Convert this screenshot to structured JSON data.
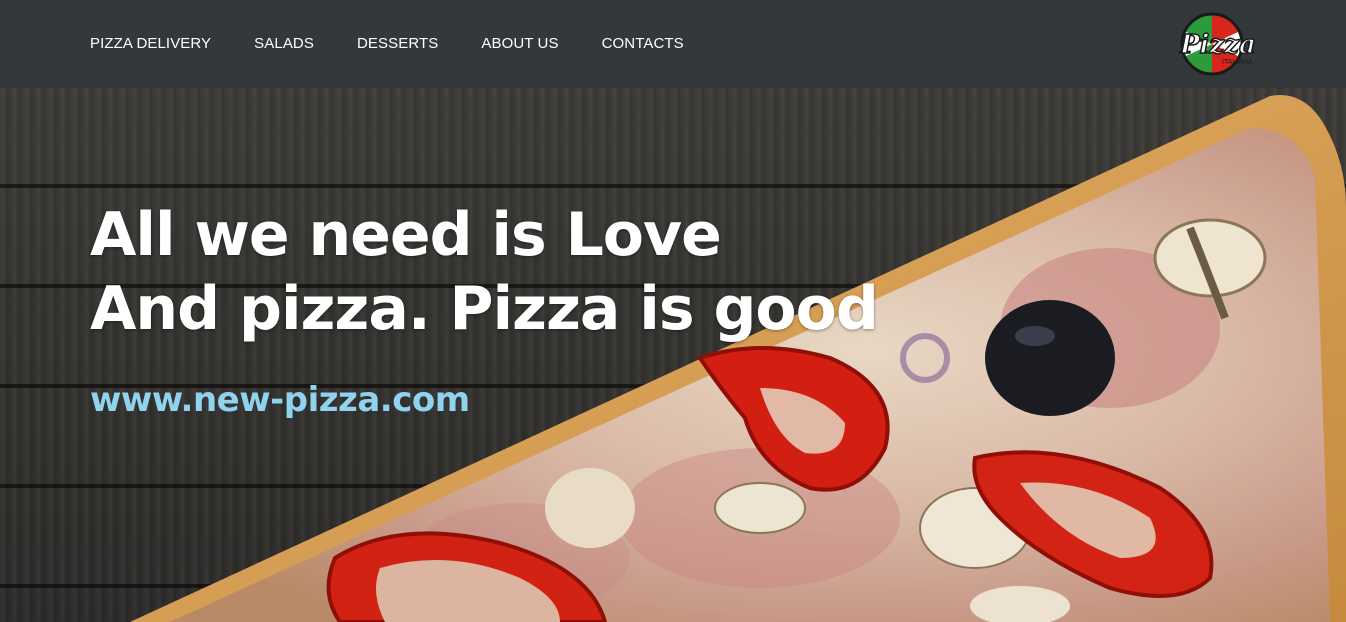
{
  "nav": {
    "items": [
      {
        "label": "PIZZA DELIVERY"
      },
      {
        "label": "SALADS"
      },
      {
        "label": "DESSERTS"
      },
      {
        "label": "ABOUT US"
      },
      {
        "label": "CONTACTS"
      }
    ]
  },
  "logo": {
    "text": "Pizza",
    "subtext": "ITALIANA",
    "colors": [
      "#2e9a3e",
      "#ffffff",
      "#d9261c"
    ]
  },
  "hero": {
    "headline_line1": "All we need is Love",
    "headline_line2": "And pizza. Pizza is good",
    "url": "www.new-pizza.com",
    "url_color": "#8fd3ee"
  }
}
